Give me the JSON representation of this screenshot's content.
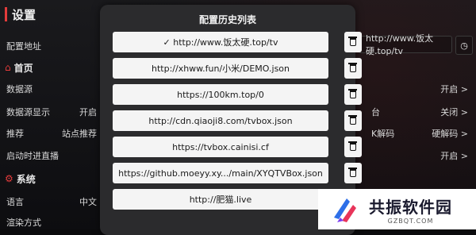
{
  "settings": {
    "title": "设置",
    "address_label": "配置地址",
    "address_value": "http://www.饭太硬.top/tv",
    "section_home": "首页",
    "section_system": "系统",
    "rows": {
      "data_source": {
        "label": "数据源",
        "right": "开启"
      },
      "data_source_display": {
        "label": "数据源显示",
        "value": "开启",
        "mid": "台",
        "right": "关闭"
      },
      "recommend": {
        "label": "推荐",
        "value": "站点推荐",
        "mid": "K解码",
        "right": "硬解码"
      },
      "startup_live": {
        "label": "启动时进直播",
        "right": "开启"
      },
      "language": {
        "label": "语言",
        "value": "中文"
      },
      "render_mode": {
        "label": "渲染方式"
      }
    },
    "chevron": ">"
  },
  "modal": {
    "title": "配置历史列表",
    "items": [
      "✓ http://www.饭太硬.top/tv",
      "http://xhww.fun/小米/DEMO.json",
      "https://100km.top/0",
      "http://cdn.qiaoji8.com/tvbox.json",
      "https://tvbox.cainisi.cf",
      "https://github.moeyy.xy.../main/XYQTVBox.json",
      "http://肥猫.live"
    ]
  },
  "watermark": {
    "name": "共振软件园",
    "domain": "GZBQT.COM"
  },
  "colors": {
    "accent": "#e33b3b",
    "modal_bg": "#2b2b2d",
    "item_bg": "#f4f4f4"
  }
}
